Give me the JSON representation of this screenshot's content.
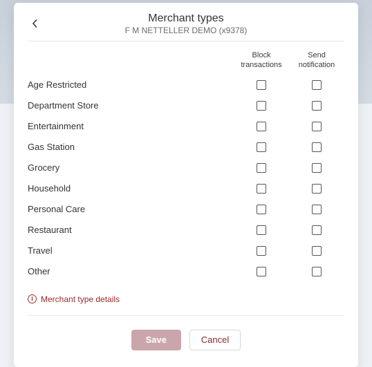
{
  "header": {
    "title": "Merchant types",
    "subtitle": "F M NETTELLER DEMO (x9378)"
  },
  "columns": {
    "block": "Block transactions",
    "notify": "Send notification"
  },
  "rows": [
    {
      "label": "Age Restricted"
    },
    {
      "label": "Department Store"
    },
    {
      "label": "Entertainment"
    },
    {
      "label": "Gas Station"
    },
    {
      "label": "Grocery"
    },
    {
      "label": "Household"
    },
    {
      "label": "Personal Care"
    },
    {
      "label": "Restaurant"
    },
    {
      "label": "Travel"
    },
    {
      "label": "Other"
    }
  ],
  "details_link": "Merchant type details",
  "actions": {
    "save": "Save",
    "cancel": "Cancel"
  }
}
